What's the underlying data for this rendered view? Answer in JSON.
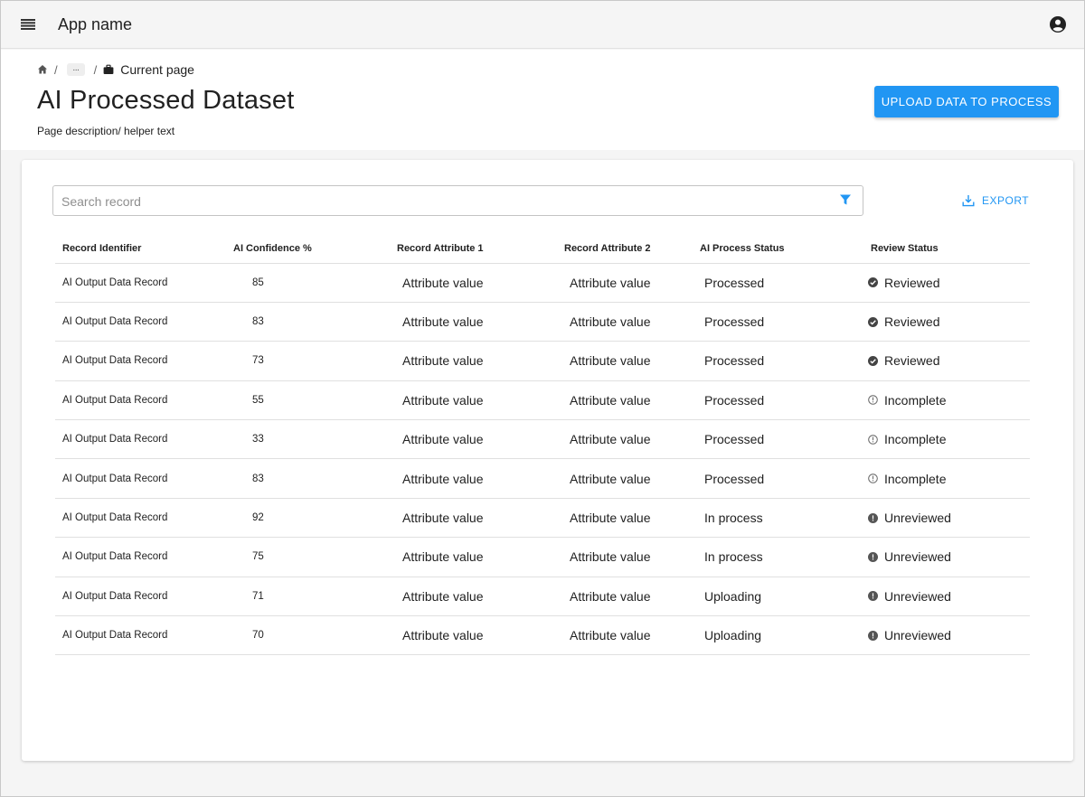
{
  "appbar": {
    "title": "App name",
    "menu_icon": "menu-icon",
    "account_icon": "account-circle-icon"
  },
  "breadcrumb": {
    "home_icon": "home-icon",
    "separator": "/",
    "more": "···",
    "current_icon": "briefcase-icon",
    "current": "Current page"
  },
  "page": {
    "title": "AI Processed Dataset",
    "description": "Page description/ helper text",
    "upload_label": "UPLOAD DATA TO PROCESS"
  },
  "toolbar": {
    "search_placeholder": "Search record",
    "filter_icon": "filter-icon",
    "export_label": "EXPORT",
    "export_icon": "download-icon"
  },
  "colors": {
    "accent": "#2196f3",
    "status_icon": "#555555"
  },
  "table": {
    "columns": [
      "Record Identifier",
      "AI Confidence %",
      "Record Attribute 1",
      "Record Attribute 2",
      "AI Process Status",
      "Review Status"
    ],
    "rows": [
      {
        "id": "AI Output Data Record",
        "confidence": "85",
        "attr1": "Attribute value",
        "attr2": "Attribute value",
        "process": "Processed",
        "review": "Reviewed",
        "review_icon": "check-circle-icon"
      },
      {
        "id": "AI Output Data Record",
        "confidence": "83",
        "attr1": "Attribute value",
        "attr2": "Attribute value",
        "process": "Processed",
        "review": "Reviewed",
        "review_icon": "check-circle-icon"
      },
      {
        "id": "AI Output Data Record",
        "confidence": "73",
        "attr1": "Attribute value",
        "attr2": "Attribute value",
        "process": "Processed",
        "review": "Reviewed",
        "review_icon": "check-circle-icon"
      },
      {
        "id": "AI Output Data Record",
        "confidence": "55",
        "attr1": "Attribute value",
        "attr2": "Attribute value",
        "process": "Processed",
        "review": "Incomplete",
        "review_icon": "info-outline-icon"
      },
      {
        "id": "AI Output Data Record",
        "confidence": "33",
        "attr1": "Attribute value",
        "attr2": "Attribute value",
        "process": "Processed",
        "review": "Incomplete",
        "review_icon": "info-outline-icon"
      },
      {
        "id": "AI Output Data Record",
        "confidence": "83",
        "attr1": "Attribute value",
        "attr2": "Attribute value",
        "process": "Processed",
        "review": "Incomplete",
        "review_icon": "info-outline-icon"
      },
      {
        "id": "AI Output Data Record",
        "confidence": "92",
        "attr1": "Attribute value",
        "attr2": "Attribute value",
        "process": "In process",
        "review": "Unreviewed",
        "review_icon": "error-filled-icon"
      },
      {
        "id": "AI Output Data Record",
        "confidence": "75",
        "attr1": "Attribute value",
        "attr2": "Attribute value",
        "process": "In process",
        "review": "Unreviewed",
        "review_icon": "error-filled-icon"
      },
      {
        "id": "AI Output Data Record",
        "confidence": "71",
        "attr1": "Attribute value",
        "attr2": "Attribute value",
        "process": "Uploading",
        "review": "Unreviewed",
        "review_icon": "error-filled-icon"
      },
      {
        "id": "AI Output Data Record",
        "confidence": "70",
        "attr1": "Attribute value",
        "attr2": "Attribute value",
        "process": "Uploading",
        "review": "Unreviewed",
        "review_icon": "error-filled-icon"
      }
    ]
  }
}
